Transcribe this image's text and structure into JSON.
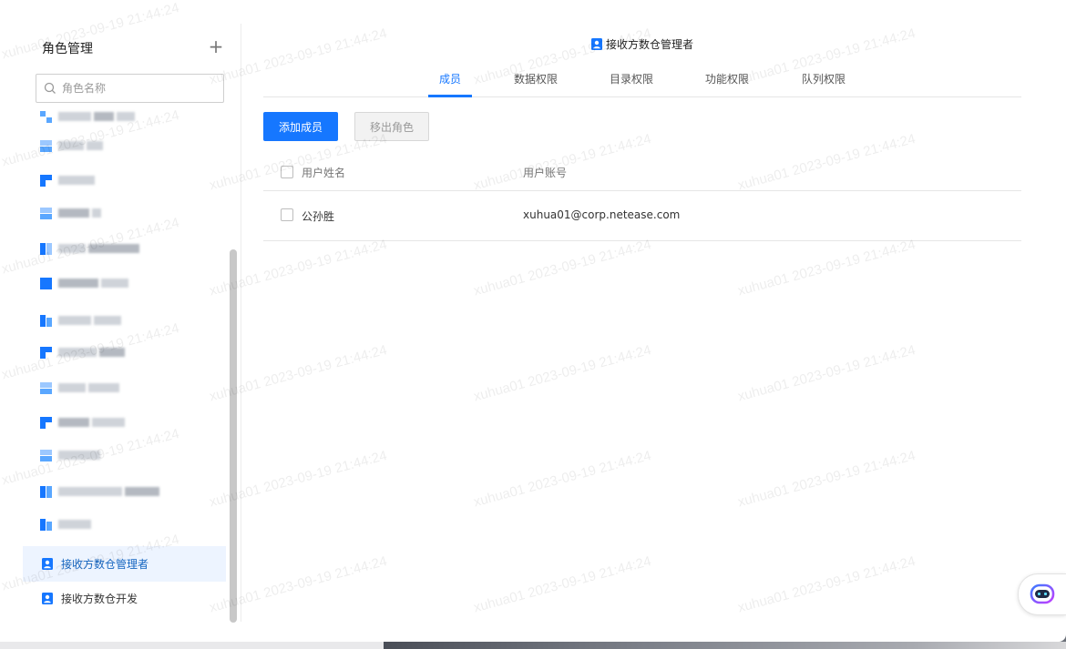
{
  "sidebar": {
    "title": "角色管理",
    "add_icon": "plus-icon",
    "search": {
      "placeholder": "角色名称",
      "value": ""
    },
    "roles_named": [
      {
        "label": "接收方数仓管理者",
        "icon": "person-badge-icon",
        "active": true
      },
      {
        "label": "接收方数仓开发",
        "icon": "person-badge-icon",
        "active": false
      }
    ]
  },
  "main": {
    "title": "接收方数仓管理者",
    "tabs": [
      {
        "label": "成员",
        "active": true
      },
      {
        "label": "数据权限",
        "active": false
      },
      {
        "label": "目录权限",
        "active": false
      },
      {
        "label": "功能权限",
        "active": false
      },
      {
        "label": "队列权限",
        "active": false
      }
    ],
    "actions": {
      "add_member": "添加成员",
      "remove_role": "移出角色"
    },
    "table": {
      "headers": [
        "用户姓名",
        "用户账号"
      ],
      "rows": [
        {
          "name": "公孙胜",
          "account": "xuhua01@corp.netease.com"
        }
      ]
    }
  },
  "watermark": "xuhua01 2023-09-19 21:44:24",
  "colors": {
    "accent": "#1677ff",
    "active_bg": "#edf4ff"
  },
  "assistant_icon": "robot-assistant-icon"
}
